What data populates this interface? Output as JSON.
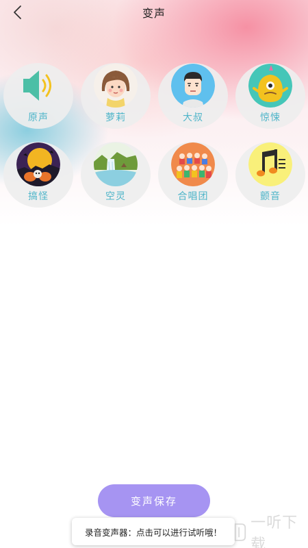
{
  "header": {
    "title": "变声"
  },
  "effects": [
    {
      "label": "原声",
      "icon": "speaker-icon"
    },
    {
      "label": "萝莉",
      "icon": "girl-avatar-icon"
    },
    {
      "label": "大叔",
      "icon": "uncle-avatar-icon"
    },
    {
      "label": "惊悚",
      "icon": "monster-icon"
    },
    {
      "label": "搞怪",
      "icon": "halloween-icon"
    },
    {
      "label": "空灵",
      "icon": "waterfall-icon"
    },
    {
      "label": "合唱团",
      "icon": "choir-icon"
    },
    {
      "label": "颤音",
      "icon": "music-note-icon"
    }
  ],
  "save_button": {
    "label": "变声保存"
  },
  "toast": {
    "text": "录音变声器：点击可以进行试听哦！"
  },
  "watermark": {
    "text": "一听下载"
  },
  "colors": {
    "label": "#4fb5c9",
    "save_button": "#a694f2",
    "speaker": "#4cbfa6",
    "speaker_wave": "#f3c21f"
  }
}
